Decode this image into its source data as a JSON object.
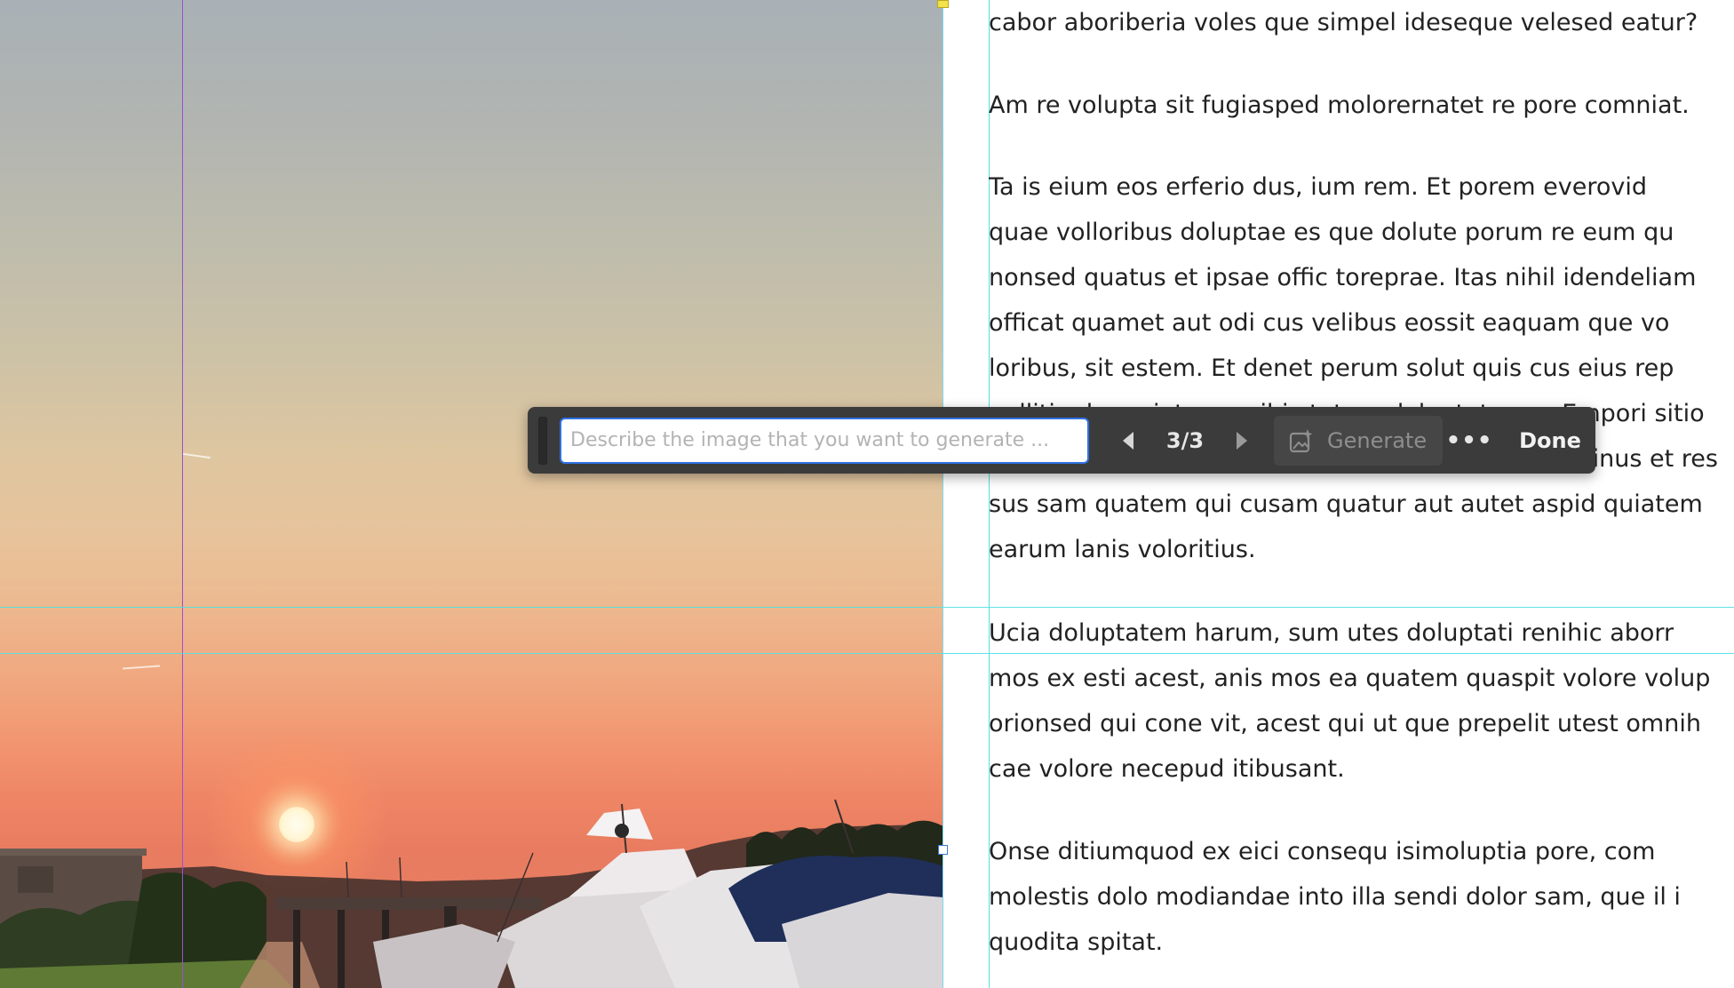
{
  "toolbar": {
    "prompt_placeholder": "Describe the image that you want to generate ...",
    "prompt_value": "",
    "page_counter": "3/3",
    "generate_label": "Generate",
    "more_label": "•••",
    "done_label": "Done",
    "icons": {
      "grip": "drag-grip-icon",
      "prev": "triangle-left-icon",
      "next": "triangle-right-icon",
      "generate": "generate-image-icon",
      "more": "more-options-icon"
    }
  },
  "document": {
    "paragraphs": [
      [
        "cabor aboriberia voles que simpel ideseque velesed eatur?"
      ],
      [
        "Am re volupta sit fugiasped molorernatet re pore comniat."
      ],
      [
        "Ta is eium eos erferio dus, ium rem. Et porem everovid",
        "quae volloribus doluptae es que dolute porum re eum qu",
        "nonsed quatus et ipsae offic toreprae. Itas nihil idendeliam",
        "officat quamet aut odi cus velibus eossit eaquam que vo",
        "loribus, sit estem. Et denet perum solut quis cus eius rep",
        "nulliti adqueniet magnihic totam doluptatquas. Empori sitio",
        "ipsum nobis volorum excepta porem, ut lorporum inus et res",
        "sus sam quatem qui cusam quatur aut autet aspid quiatem",
        "earum lanis voloritius."
      ],
      [
        "Ucia doluptatem harum, sum utes doluptati renihic aborr",
        "mos ex esti acest, anis mos ea quatem quaspit volore volup",
        "orionsed qui cone vit, acest qui ut que prepelit utest omnih",
        "cae volore necepud itibusant."
      ],
      [
        "Onse ditiumquod ex eici consequ isimoluptia pore, com",
        "molestis dolo modiandae into illa sendi dolor sam, que il i",
        "quodita spitat."
      ]
    ]
  },
  "colors": {
    "toolbar_bg": "#3b3b3b",
    "input_focus": "#2f72e4",
    "guide_cyan": "#4fe0e6",
    "guide_violet": "#9b4fd6",
    "text": "#222222"
  }
}
